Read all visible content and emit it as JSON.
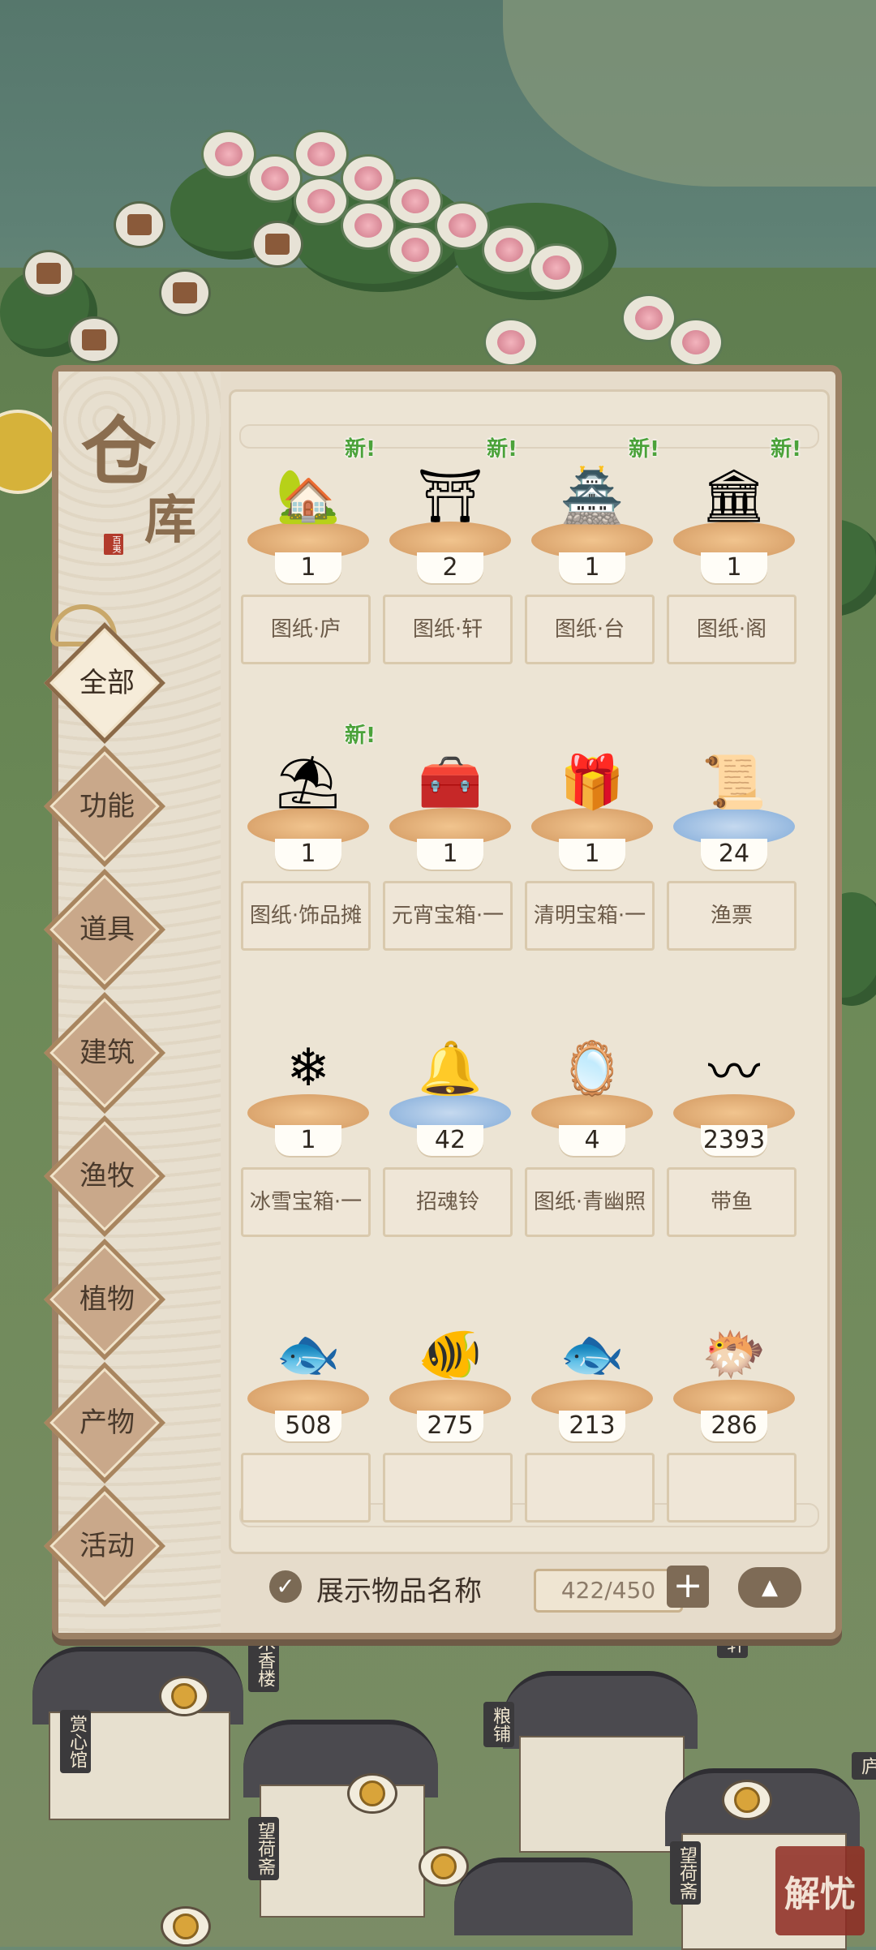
{
  "panel": {
    "title_char1": "仓",
    "title_char2": "库",
    "title_seal": "百夷"
  },
  "categories": [
    {
      "label": "全部",
      "active": true
    },
    {
      "label": "功能",
      "active": false
    },
    {
      "label": "道具",
      "active": false
    },
    {
      "label": "建筑",
      "active": false
    },
    {
      "label": "渔牧",
      "active": false
    },
    {
      "label": "植物",
      "active": false
    },
    {
      "label": "产物",
      "active": false
    },
    {
      "label": "活动",
      "active": false
    }
  ],
  "new_badge": "新!",
  "items": [
    {
      "name": "图纸·庐",
      "count": "1",
      "new": true,
      "icon": "blueprint-hut-icon"
    },
    {
      "name": "图纸·轩",
      "count": "2",
      "new": true,
      "icon": "blueprint-pavilion-icon"
    },
    {
      "name": "图纸·台",
      "count": "1",
      "new": true,
      "icon": "blueprint-terrace-icon"
    },
    {
      "name": "图纸·阁",
      "count": "1",
      "new": true,
      "icon": "blueprint-tower-icon"
    },
    {
      "name": "图纸·饰品摊",
      "count": "1",
      "new": true,
      "icon": "blueprint-stall-icon"
    },
    {
      "name": "元宵宝箱·一",
      "count": "1",
      "new": false,
      "icon": "lantern-chest-icon"
    },
    {
      "name": "清明宝箱·一",
      "count": "1",
      "new": false,
      "icon": "qingming-chest-icon"
    },
    {
      "name": "渔票",
      "count": "24",
      "new": false,
      "icon": "fishing-ticket-icon"
    },
    {
      "name": "冰雪宝箱·一",
      "count": "1",
      "new": false,
      "icon": "ice-chest-icon"
    },
    {
      "name": "招魂铃",
      "count": "42",
      "new": false,
      "icon": "bell-icon"
    },
    {
      "name": "图纸·青幽照",
      "count": "4",
      "new": false,
      "icon": "blueprint-mirror-icon"
    },
    {
      "name": "带鱼",
      "count": "2393",
      "new": false,
      "icon": "ribbonfish-icon"
    },
    {
      "name": "",
      "count": "508",
      "new": false,
      "icon": "fish-red-icon"
    },
    {
      "name": "",
      "count": "275",
      "new": false,
      "icon": "fish-orange-icon"
    },
    {
      "name": "",
      "count": "213",
      "new": false,
      "icon": "fish-yellow-icon"
    },
    {
      "name": "",
      "count": "286",
      "new": false,
      "icon": "fish-spotted-icon"
    }
  ],
  "footer": {
    "show_names_label": "展示物品名称",
    "show_names_checked": true,
    "capacity": "422/450",
    "plus_label": "+",
    "collapse_label": "▲"
  },
  "scene": {
    "signs": [
      "赏心馆",
      "木香楼",
      "望荷斋",
      "粮铺",
      "望荷斋",
      "轩",
      "庐"
    ],
    "stamp": "解忧"
  }
}
